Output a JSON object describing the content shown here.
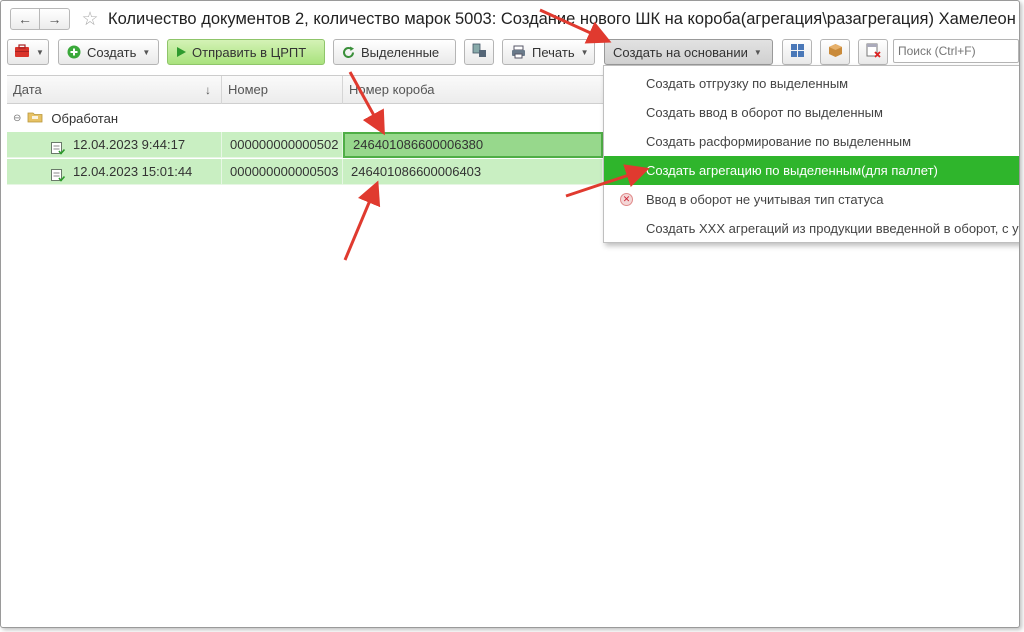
{
  "window": {
    "title": "Количество документов 2, количество марок 5003: Создание нового ШК на короба(агрегация\\разагрегация) Хамелеон"
  },
  "nav": {
    "back_icon": "←",
    "forward_icon": "→",
    "star_icon": "☆"
  },
  "toolbar": {
    "create_label": "Создать",
    "send_label": "Отправить в ЦРПТ",
    "selected_label": "Выделенные",
    "print_label": "Печать",
    "create_based_label": "Создать на основании",
    "search_placeholder": "Поиск (Ctrl+F)"
  },
  "table": {
    "columns": [
      "Дата",
      "Номер",
      "Номер короба"
    ],
    "sort_indicator": "↓",
    "group_label": "Обработан",
    "rows": [
      {
        "date": "12.04.2023 9:44:17",
        "number": "000000000000502",
        "box": "246401086600006380"
      },
      {
        "date": "12.04.2023 15:01:44",
        "number": "000000000000503",
        "box": "246401086600006403"
      }
    ]
  },
  "menu": {
    "items": [
      "Создать отгрузку по выделенным",
      "Создать ввод в оборот по выделенным",
      "Создать расформирование по выделенным",
      "Создать агрегацию по выделенным(для паллет)",
      "Ввод в оборот не учитывая тип статуса",
      "Создать XXX агрегаций из продукции введенной в оборот, с упаковкой"
    ],
    "active_index": 3
  },
  "colors": {
    "accent_green": "#2fb52c",
    "row_green": "#c9efc2",
    "annotation_red": "#e03a2f"
  }
}
